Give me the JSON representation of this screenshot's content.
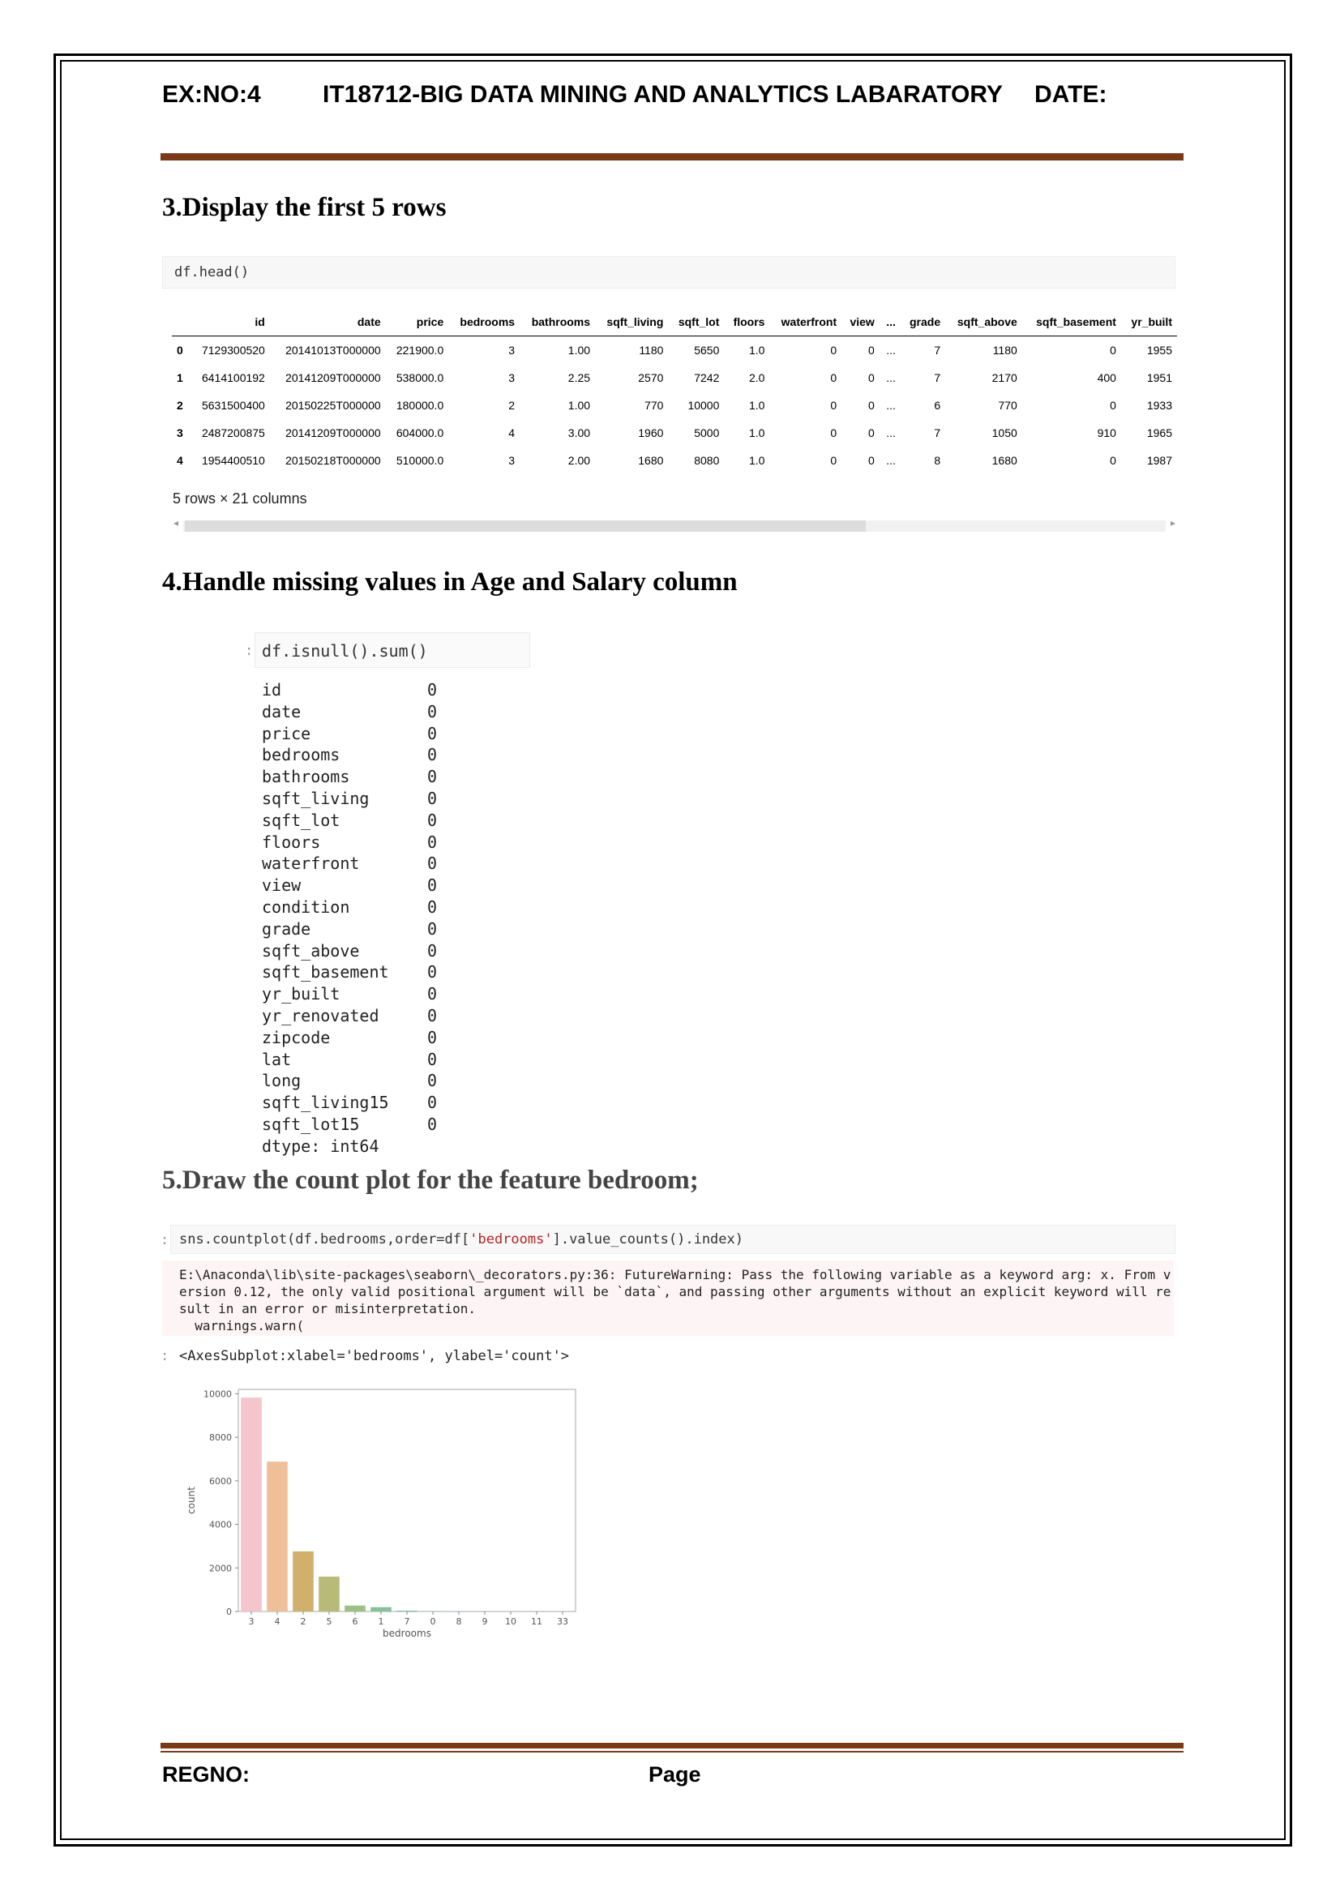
{
  "header": {
    "ex_no": "EX:NO:4",
    "course_title": "IT18712-BIG DATA MINING AND ANALYTICS LABARATORY",
    "date_label": "DATE:"
  },
  "section3": {
    "title": "3.Display the first 5 rows",
    "code": "df.head()",
    "table": {
      "columns": [
        "",
        "id",
        "date",
        "price",
        "bedrooms",
        "bathrooms",
        "sqft_living",
        "sqft_lot",
        "floors",
        "waterfront",
        "view",
        "...",
        "grade",
        "sqft_above",
        "sqft_basement",
        "yr_built"
      ],
      "rows": [
        [
          "0",
          "7129300520",
          "20141013T000000",
          "221900.0",
          "3",
          "1.00",
          "1180",
          "5650",
          "1.0",
          "0",
          "0",
          "...",
          "7",
          "1180",
          "0",
          "1955"
        ],
        [
          "1",
          "6414100192",
          "20141209T000000",
          "538000.0",
          "3",
          "2.25",
          "2570",
          "7242",
          "2.0",
          "0",
          "0",
          "...",
          "7",
          "2170",
          "400",
          "1951"
        ],
        [
          "2",
          "5631500400",
          "20150225T000000",
          "180000.0",
          "2",
          "1.00",
          "770",
          "10000",
          "1.0",
          "0",
          "0",
          "...",
          "6",
          "770",
          "0",
          "1933"
        ],
        [
          "3",
          "2487200875",
          "20141209T000000",
          "604000.0",
          "4",
          "3.00",
          "1960",
          "5000",
          "1.0",
          "0",
          "0",
          "...",
          "7",
          "1050",
          "910",
          "1965"
        ],
        [
          "4",
          "1954400510",
          "20150218T000000",
          "510000.0",
          "3",
          "2.00",
          "1680",
          "8080",
          "1.0",
          "0",
          "0",
          "...",
          "8",
          "1680",
          "0",
          "1987"
        ]
      ]
    },
    "shape_note": "5 rows × 21 columns"
  },
  "section4": {
    "title": "4.Handle missing values in Age and Salary column",
    "code_prompt": ":",
    "code": "df.isnull().sum()",
    "rows": [
      {
        "k": "id",
        "v": "0"
      },
      {
        "k": "date",
        "v": "0"
      },
      {
        "k": "price",
        "v": "0"
      },
      {
        "k": "bedrooms",
        "v": "0"
      },
      {
        "k": "bathrooms",
        "v": "0"
      },
      {
        "k": "sqft_living",
        "v": "0"
      },
      {
        "k": "sqft_lot",
        "v": "0"
      },
      {
        "k": "floors",
        "v": "0"
      },
      {
        "k": "waterfront",
        "v": "0"
      },
      {
        "k": "view",
        "v": "0"
      },
      {
        "k": "condition",
        "v": "0"
      },
      {
        "k": "grade",
        "v": "0"
      },
      {
        "k": "sqft_above",
        "v": "0"
      },
      {
        "k": "sqft_basement",
        "v": "0"
      },
      {
        "k": "yr_built",
        "v": "0"
      },
      {
        "k": "yr_renovated",
        "v": "0"
      },
      {
        "k": "zipcode",
        "v": "0"
      },
      {
        "k": "lat",
        "v": "0"
      },
      {
        "k": "long",
        "v": "0"
      },
      {
        "k": "sqft_living15",
        "v": "0"
      },
      {
        "k": "sqft_lot15",
        "v": "0"
      }
    ],
    "dtype": "dtype: int64"
  },
  "section5": {
    "title": "5.Draw the count plot for the feature bedroom;",
    "code_prompt": ":",
    "code_parts": [
      "sns.countplot(df.bedrooms,order=df[",
      "'bedrooms'",
      "].value_counts().index)"
    ],
    "warning_lines": [
      "E:\\Anaconda\\lib\\site-packages\\seaborn\\_decorators.py:36: FutureWarning: Pass the following variable as a keyword arg: x. From v",
      "ersion 0.12, the only valid positional argument will be `data`, and passing other arguments without an explicit keyword will re",
      "sult in an error or misinterpretation.",
      "  warnings.warn("
    ],
    "out_prompt": ":",
    "output": "<AxesSubplot:xlabel='bedrooms', ylabel='count'>"
  },
  "chart_data": {
    "type": "bar",
    "categories": [
      "3",
      "4",
      "2",
      "5",
      "6",
      "1",
      "7",
      "0",
      "8",
      "9",
      "10",
      "11",
      "33"
    ],
    "values": [
      9824,
      6882,
      2760,
      1601,
      272,
      199,
      38,
      13,
      13,
      6,
      3,
      1,
      1
    ],
    "colors": [
      "#f5c5cd",
      "#efbf9a",
      "#d0b06a",
      "#b8ba78",
      "#9dc084",
      "#85c19a",
      "#7bbfb2",
      "#79bbc4",
      "#86b6d4",
      "#a2aedc",
      "#bba6da",
      "#d4a3d2",
      "#e8a7c8"
    ],
    "xlabel": "bedrooms",
    "ylabel": "count",
    "ylim": [
      0,
      10200
    ],
    "yticks": [
      "0",
      "2000",
      "4000",
      "6000",
      "8000",
      "10000"
    ],
    "grid": false
  },
  "footer": {
    "regno_label": "REGNO:",
    "page_label": "Page"
  }
}
